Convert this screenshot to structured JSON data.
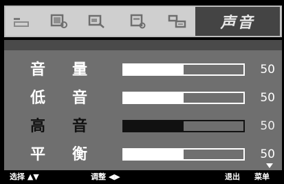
{
  "tabs": [
    {
      "icon": "picture-adjust-icon"
    },
    {
      "icon": "source-input-icon"
    },
    {
      "icon": "screen-select-icon"
    },
    {
      "icon": "timer-settings-icon"
    },
    {
      "icon": "layout-settings-icon"
    }
  ],
  "active_tab": {
    "label": "声音"
  },
  "settings": [
    {
      "label_char1": "音",
      "label_char2": "量",
      "value": "50",
      "level": 0.5,
      "selected": false
    },
    {
      "label_char1": "低",
      "label_char2": "音",
      "value": "50",
      "level": 0.5,
      "selected": false
    },
    {
      "label_char1": "高",
      "label_char2": "音",
      "value": "50",
      "level": 0.5,
      "selected": true
    },
    {
      "label_char1": "平",
      "label_char2": "衡",
      "value": "50",
      "level": 0.5,
      "selected": false
    }
  ],
  "hints": {
    "select": "选择 ▲▼",
    "adjust": "调整 ◀▶",
    "exit": "退出",
    "menu": "菜单"
  },
  "colors": {
    "panel": "#6f6f6f",
    "tabbar": "#cfcfcf",
    "active_tab": "#444444"
  }
}
